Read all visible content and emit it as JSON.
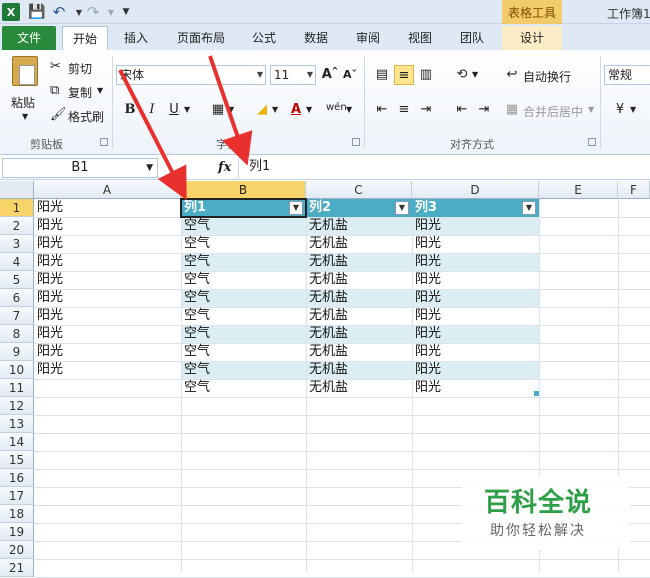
{
  "titlebar": {
    "app_logo": "X",
    "table_tools": "表格工具",
    "window_title": "工作簿1"
  },
  "tabs": [
    {
      "label": "文件"
    },
    {
      "label": "开始"
    },
    {
      "label": "插入"
    },
    {
      "label": "页面布局"
    },
    {
      "label": "公式"
    },
    {
      "label": "数据"
    },
    {
      "label": "审阅"
    },
    {
      "label": "视图"
    },
    {
      "label": "团队"
    },
    {
      "label": "设计"
    }
  ],
  "ribbon": {
    "clipboard": {
      "paste": "粘贴",
      "cut": "剪切",
      "copy": "复制",
      "format_painter": "格式刷",
      "label": "剪贴板"
    },
    "font": {
      "name": "宋体",
      "size": "11",
      "bold": "B",
      "italic": "I",
      "underline": "U",
      "label": "字体"
    },
    "alignment": {
      "wrap": "自动换行",
      "merge": "合并后居中",
      "label": "对齐方式"
    },
    "number": {
      "format": "常规"
    }
  },
  "formula_bar": {
    "name_box": "B1",
    "fx": "fx",
    "value": "列1"
  },
  "grid": {
    "columns": [
      "A",
      "B",
      "C",
      "D",
      "E",
      "F"
    ],
    "rows": [
      "1",
      "2",
      "3",
      "4",
      "5",
      "6",
      "7",
      "8",
      "9",
      "10",
      "11",
      "12",
      "13",
      "14",
      "15",
      "16",
      "17",
      "18",
      "19",
      "20",
      "21"
    ],
    "table_headers": [
      "列1",
      "列2",
      "列3"
    ],
    "col_a": [
      "阳光",
      "阳光",
      "阳光",
      "阳光",
      "阳光",
      "阳光",
      "阳光",
      "阳光",
      "阳光",
      "阳光"
    ],
    "col_b": [
      "空气",
      "空气",
      "空气",
      "空气",
      "空气",
      "空气",
      "空气",
      "空气",
      "空气",
      "空气"
    ],
    "col_c": [
      "无机盐",
      "无机盐",
      "无机盐",
      "无机盐",
      "无机盐",
      "无机盐",
      "无机盐",
      "无机盐",
      "无机盐",
      "无机盐"
    ],
    "col_d": [
      "阳光",
      "阳光",
      "阳光",
      "阳光",
      "阳光",
      "阳光",
      "阳光",
      "阳光",
      "阳光",
      "阳光"
    ]
  },
  "watermark": {
    "title": "百科全说",
    "subtitle": "助你轻松解决"
  },
  "colors": {
    "table_header": "#4bacc6",
    "table_band": "#daeef3",
    "file_tab": "#2a8a3c",
    "arrow": "#e8312f"
  }
}
